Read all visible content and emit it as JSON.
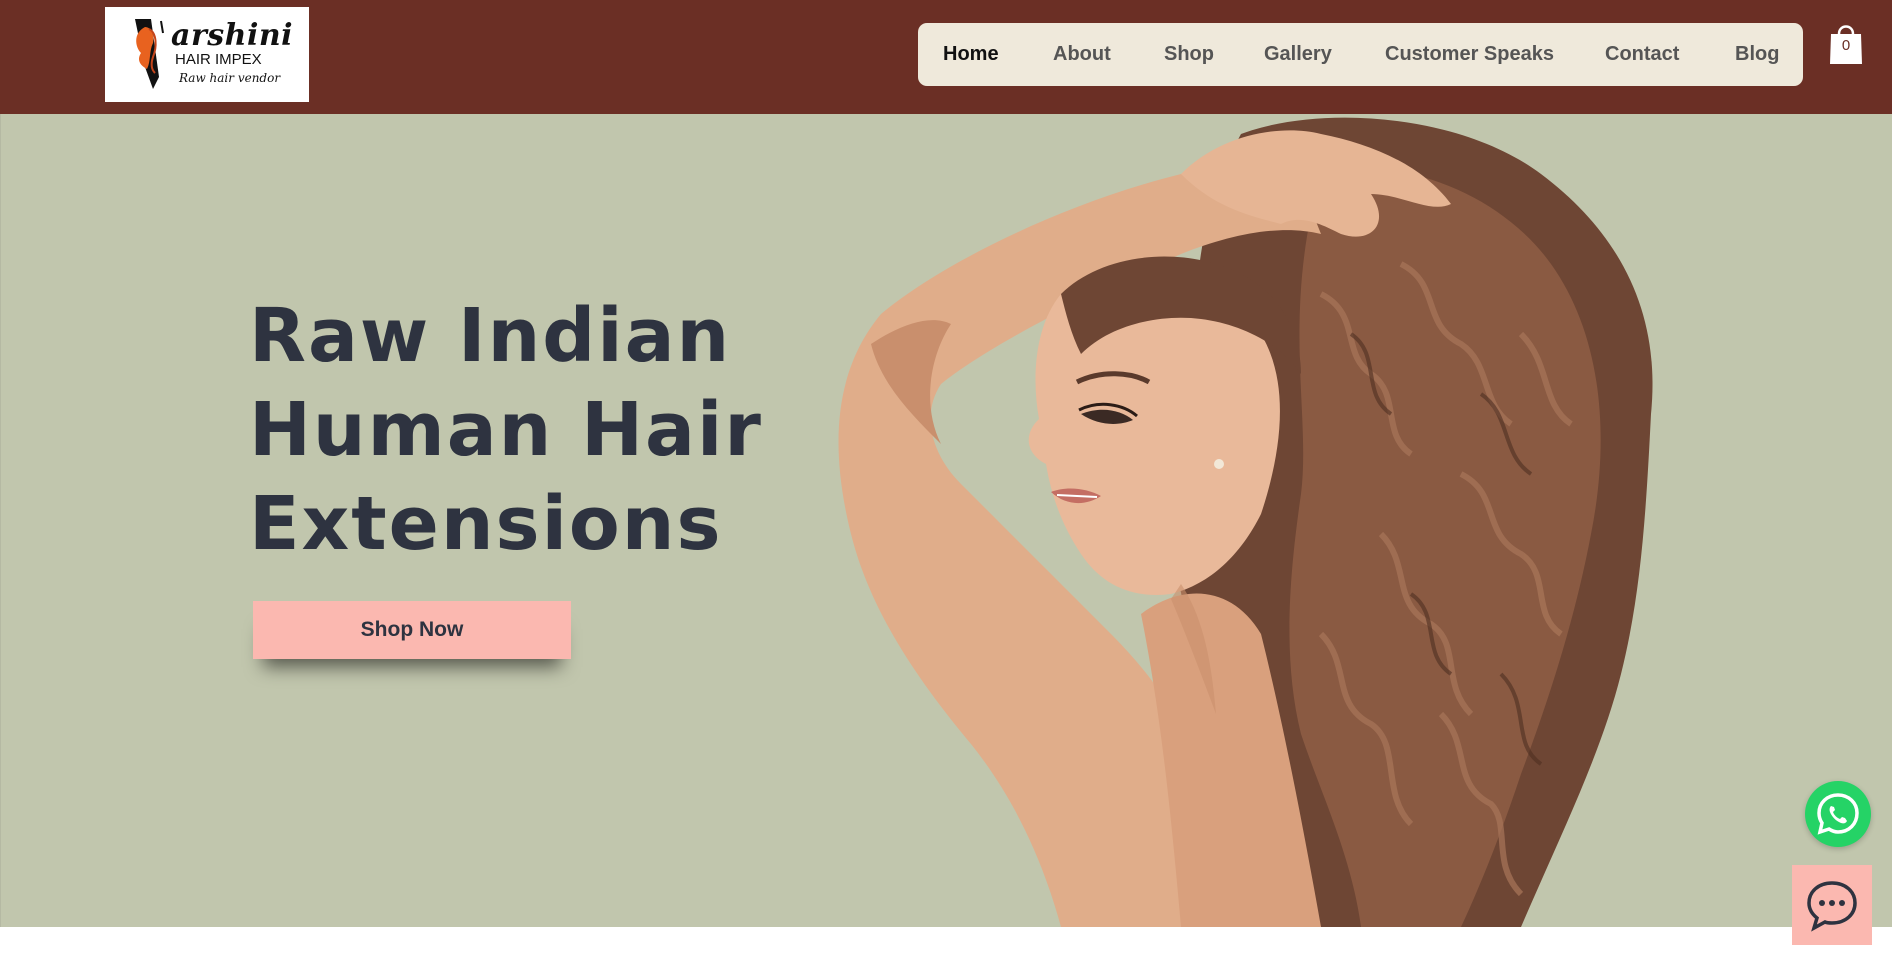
{
  "brand": {
    "logo_main": "arshini",
    "logo_sub": "HAIR IMPEX",
    "logo_tagline": "Raw hair vendor",
    "header_color": "#6b2f25"
  },
  "nav": {
    "items": [
      {
        "label": "Home",
        "active": true
      },
      {
        "label": "About"
      },
      {
        "label": "Shop"
      },
      {
        "label": "Gallery"
      },
      {
        "label": "Customer Speaks"
      },
      {
        "label": "Contact"
      },
      {
        "label": "Blog"
      }
    ]
  },
  "cart": {
    "count": "0",
    "icon": "shopping-bag-icon"
  },
  "hero": {
    "title_lines": [
      "Raw Indian",
      "Human Hair",
      "Extensions"
    ],
    "cta_label": "Shop Now",
    "background": "#c1c6ad",
    "cta_color": "#fbb8b0"
  },
  "floating": {
    "whatsapp_icon": "whatsapp-icon",
    "chat_icon": "chat-bubble-icon"
  }
}
